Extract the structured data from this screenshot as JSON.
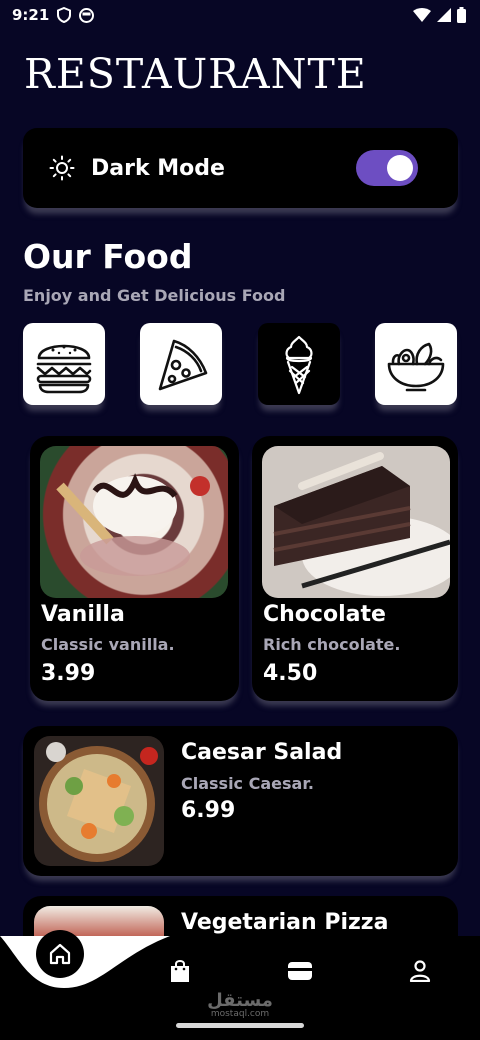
{
  "status_bar": {
    "time": "9:21"
  },
  "app": {
    "title": "RESTAURANTE"
  },
  "settings": {
    "dark_mode_label": "Dark Mode",
    "dark_mode_on": true
  },
  "section": {
    "title": "Our Food",
    "subtitle": "Enjoy and Get Delicious Food"
  },
  "categories": [
    {
      "icon": "burger-icon",
      "active": false
    },
    {
      "icon": "pizza-icon",
      "active": false
    },
    {
      "icon": "ice-cream-icon",
      "active": true
    },
    {
      "icon": "salad-bowl-icon",
      "active": false
    }
  ],
  "featured": [
    {
      "name": "Vanilla",
      "description": "Classic vanilla.",
      "price": "3.99"
    },
    {
      "name": "Chocolate",
      "description": "Rich chocolate.",
      "price": "4.50"
    }
  ],
  "list": [
    {
      "name": "Caesar Salad",
      "description": "Classic Caesar.",
      "price": "6.99"
    },
    {
      "name": "Vegetarian Pizza"
    }
  ],
  "watermark": {
    "arabic": "مستقل",
    "domain": "mostaql.com"
  },
  "colors": {
    "background": "#070625",
    "accent": "#6d4ec2",
    "card": "#000000",
    "muted_text": "#a9a7b6"
  }
}
